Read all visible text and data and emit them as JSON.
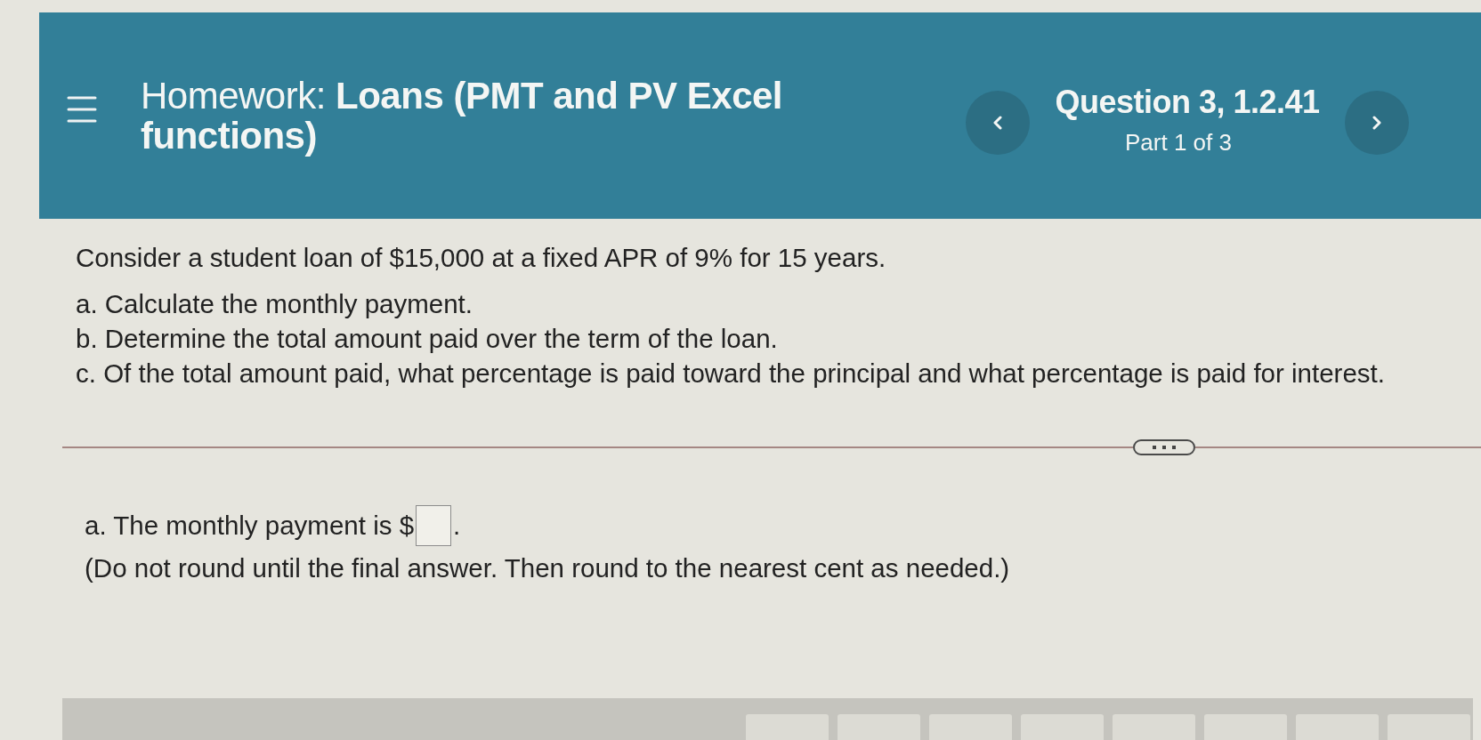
{
  "header": {
    "title": "Homework: **Loans (PMT and PV Excel functions)**",
    "question": "Question 3, 1.2.41",
    "part": "Part 1 of 3"
  },
  "problem": {
    "statement": "Consider a student loan of $15,000 at a fixed APR of 9% for 15 years.",
    "tasks": [
      "a. Calculate the monthly payment.",
      "b. Determine the total amount paid over the term of the loan.",
      "c. Of the total amount paid, what percentage is paid toward the principal and what percentage is paid for interest."
    ]
  },
  "answer": {
    "prompt": "a. The monthly payment is $",
    "suffix": ".",
    "note": "(Do not round until the final answer. Then round to the nearest cent as needed.)"
  }
}
